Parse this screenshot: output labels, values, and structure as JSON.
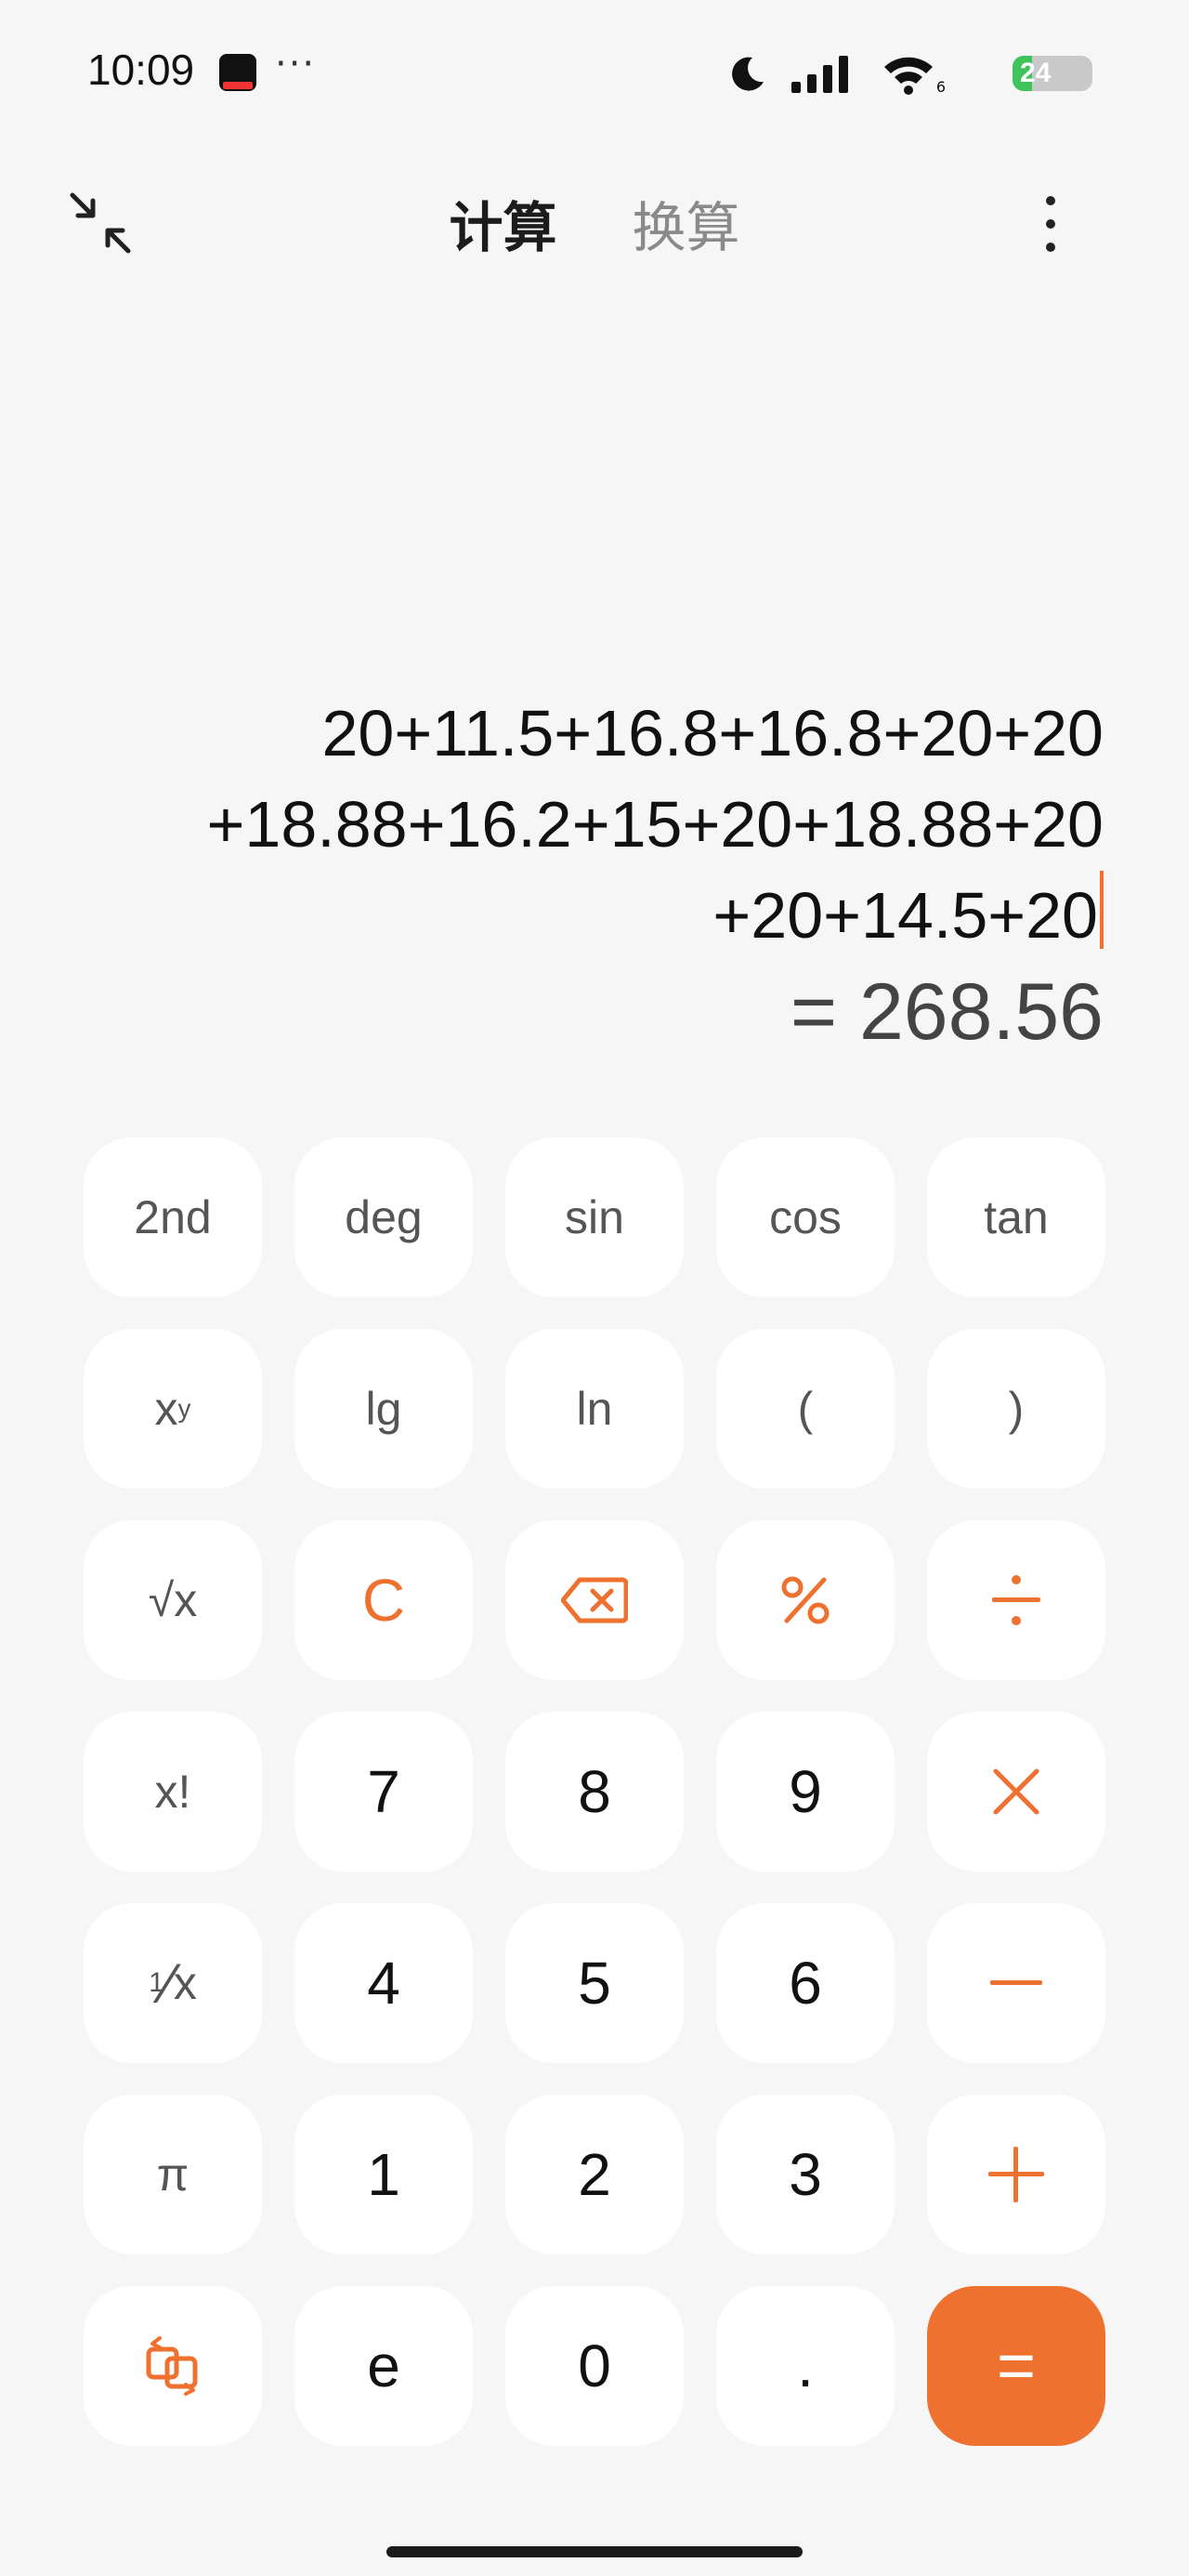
{
  "status_bar": {
    "time": "10:09",
    "more": "···",
    "wifi_sub": "6",
    "battery_text": "24",
    "battery_level": 0.24,
    "battery_color": "#3fc35b"
  },
  "header": {
    "tabs": [
      {
        "label": "计算",
        "active": true
      },
      {
        "label": "换算",
        "active": false
      }
    ]
  },
  "display": {
    "expression_lines": [
      "20+11.5+16.8+16.8+20+20",
      "+18.88+16.2+15+20+18.88+20",
      "+20+14.5+20"
    ],
    "result": "= 268.56"
  },
  "colors": {
    "accent": "#ef7130",
    "background": "#f6f6f6",
    "key_background": "#ffffff"
  },
  "keypad": {
    "row1": [
      "2nd",
      "deg",
      "sin",
      "cos",
      "tan"
    ],
    "row2_x": "x",
    "row2_y": "y",
    "row2": [
      "lg",
      "ln",
      "(",
      ")"
    ],
    "row3_sqrt": "√x",
    "row3": [
      "C"
    ],
    "row4": [
      "x!",
      "7",
      "8",
      "9"
    ],
    "row5_one": "1",
    "row5_x": "x",
    "row5": [
      "4",
      "5",
      "6"
    ],
    "row6": [
      "π",
      "1",
      "2",
      "3"
    ],
    "row7": [
      "e",
      "0",
      ".",
      "="
    ]
  }
}
